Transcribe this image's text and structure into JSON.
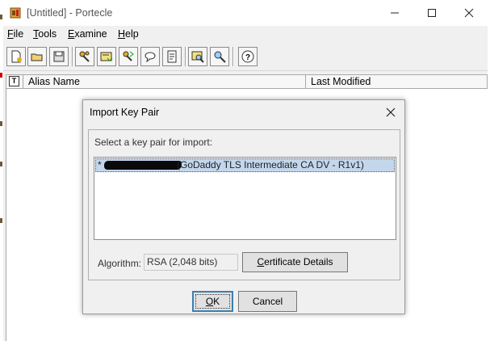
{
  "window": {
    "title": "[Untitled] - Portecle",
    "controls": [
      "minimize",
      "maximize",
      "close"
    ]
  },
  "menubar": {
    "items": [
      {
        "label": "File",
        "mnemonic": "F",
        "rest": "ile"
      },
      {
        "label": "Tools",
        "mnemonic": "T",
        "rest": "ools"
      },
      {
        "label": "Examine",
        "mnemonic": "E",
        "rest": "xamine"
      },
      {
        "label": "Help",
        "mnemonic": "H",
        "rest": "elp"
      }
    ]
  },
  "toolbar": {
    "buttons": [
      "new-keystore",
      "open-keystore",
      "save-keystore",
      "generate-key-pair",
      "import-trusted-certificate",
      "import-key-pair",
      "set-password",
      "keystore-report",
      "examine-certificate",
      "examine-ssl",
      "help"
    ]
  },
  "table": {
    "type_icon": "T",
    "columns": [
      "Alias Name",
      "Last Modified"
    ]
  },
  "dialog": {
    "title": "Import Key Pair",
    "prompt": "Select a key pair for import:",
    "key_pairs": [
      {
        "prefix": "*",
        "description": "(GoDaddy TLS Intermediate CA DV - R1v1)",
        "selected": true
      }
    ],
    "algorithm_label": "Algorithm:",
    "algorithm_value": "RSA (2,048 bits)",
    "certificate_details": {
      "mnemonic": "C",
      "rest": "ertificate Details"
    },
    "ok": {
      "mnemonic": "O",
      "rest": "K"
    },
    "cancel": "Cancel"
  },
  "colors": {
    "selection": "#c3d7ec",
    "default_button_border": "#3c7fb1"
  }
}
